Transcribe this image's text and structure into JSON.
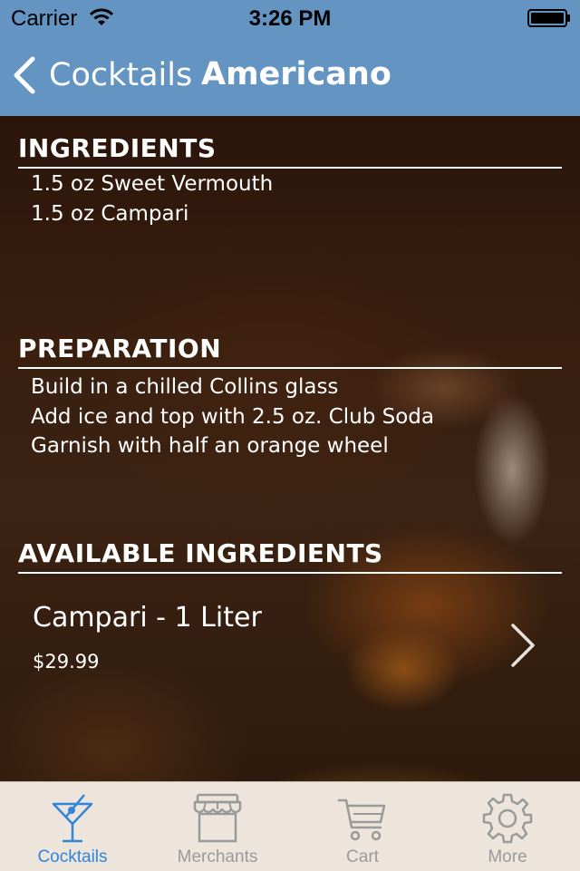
{
  "status_bar": {
    "carrier": "Carrier",
    "time": "3:26 PM"
  },
  "nav": {
    "back_label": "Cocktails",
    "title": "Americano"
  },
  "ingredients": {
    "heading": "INGREDIENTS",
    "items": [
      "1.5 oz Sweet Vermouth",
      "1.5 oz Campari"
    ]
  },
  "preparation": {
    "heading": "PREPARATION",
    "steps": [
      "Build in a chilled Collins glass",
      "Add ice and top with 2.5 oz. Club Soda",
      "Garnish with half an orange wheel"
    ]
  },
  "available": {
    "heading": "AVAILABLE INGREDIENTS",
    "products": [
      {
        "name": "Campari - 1 Liter",
        "price": "$29.99"
      }
    ]
  },
  "tabs": [
    {
      "label": "Cocktails",
      "icon": "martini-glass-icon",
      "active": true
    },
    {
      "label": "Merchants",
      "icon": "storefront-icon",
      "active": false
    },
    {
      "label": "Cart",
      "icon": "cart-icon",
      "active": false
    },
    {
      "label": "More",
      "icon": "gear-icon",
      "active": false
    }
  ],
  "colors": {
    "nav_bar": "#6494c2",
    "tab_active": "#2f86da",
    "tab_inactive": "#9a9a9a",
    "tab_bar": "#ede4dc"
  }
}
